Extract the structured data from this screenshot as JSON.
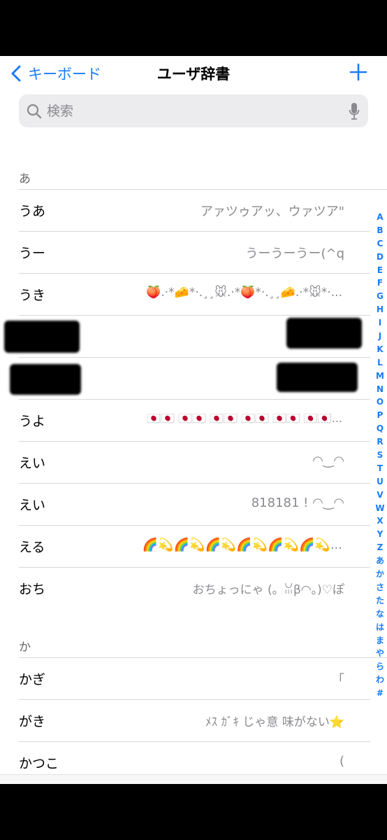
{
  "nav": {
    "back_label": "キーボード",
    "title": "ユーザ辞書"
  },
  "search": {
    "placeholder": "検索"
  },
  "sections": [
    {
      "header": "あ",
      "rows": [
        {
          "word": "うあ",
          "reading": "アァツゥアッ、ウァツア\""
        },
        {
          "word": "うー",
          "reading": "うーうーうー(^q"
        },
        {
          "word": "うき",
          "reading": "🍑.·*🧀*·.¸¸🐭.·*🍑*·.¸¸🧀.·*🐭*·..."
        },
        {
          "word": "",
          "reading": "",
          "redacted": true
        },
        {
          "word": "",
          "reading": "",
          "redacted": true
        },
        {
          "word": "うよ",
          "reading": "🇯🇵🇯🇵 🇯🇵🇯🇵 🇯🇵🇯🇵 🇯🇵🇯🇵 🇯🇵🇯🇵 🇯🇵🇯🇵..."
        },
        {
          "word": "えい",
          "reading": "◠‿◠"
        },
        {
          "word": "えい",
          "reading": "818181 ! ◠‿◠"
        },
        {
          "word": "える",
          "reading": "🌈💫🌈💫🌈💫🌈💫🌈💫🌈💫..."
        },
        {
          "word": "おち",
          "reading": "おちょっにゃ (。ꈍβ◠。)♡ぽ"
        }
      ]
    },
    {
      "header": "か",
      "rows": [
        {
          "word": "かぎ",
          "reading": "「"
        },
        {
          "word": "がき",
          "reading": "ﾒｽ ｶﾞｷ じゃ意 味がない⭐"
        },
        {
          "word": "かつこ",
          "reading": "("
        }
      ]
    }
  ],
  "index": [
    "A",
    "B",
    "C",
    "D",
    "E",
    "F",
    "G",
    "H",
    "I",
    "J",
    "K",
    "L",
    "M",
    "N",
    "O",
    "P",
    "Q",
    "R",
    "S",
    "T",
    "U",
    "V",
    "W",
    "X",
    "Y",
    "Z",
    "あ",
    "か",
    "さ",
    "た",
    "な",
    "は",
    "ま",
    "や",
    "ら",
    "わ",
    "#"
  ],
  "colors": {
    "accent": "#1a7cf5",
    "secondary_text": "#8a8a8f",
    "search_bg": "#ececee"
  }
}
